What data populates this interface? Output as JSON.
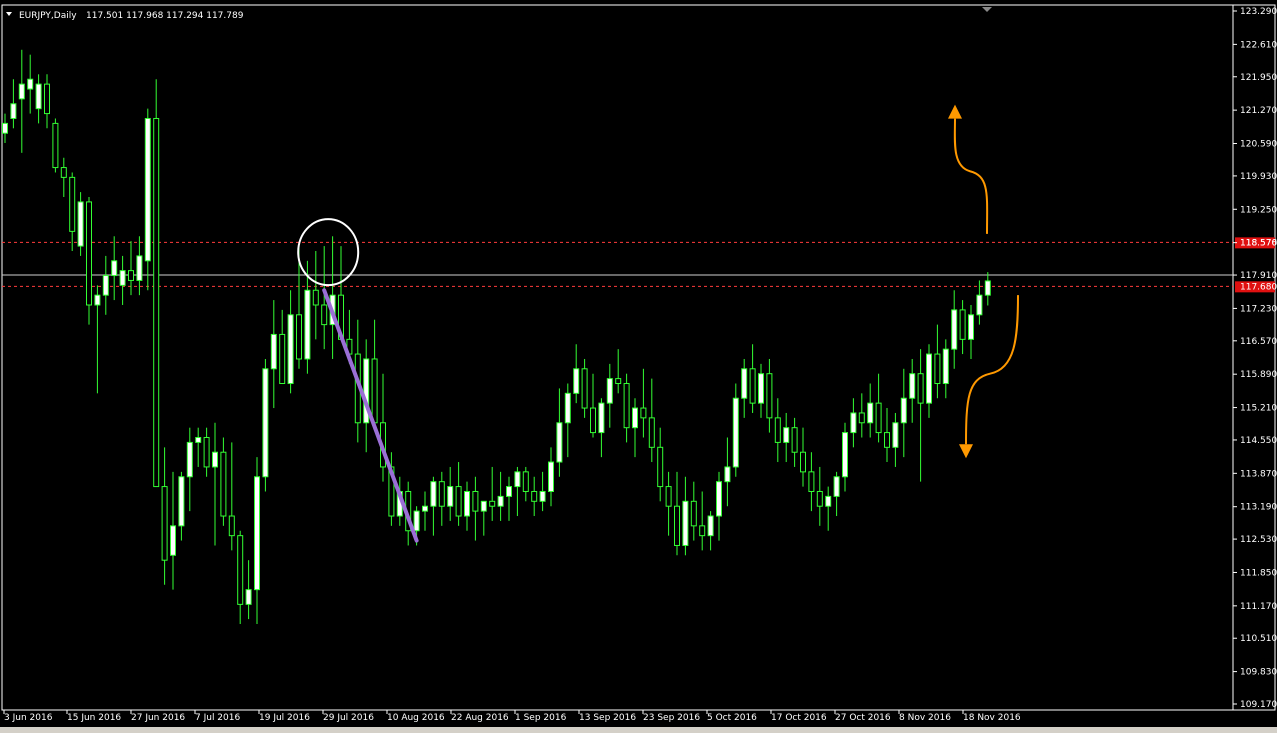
{
  "header": {
    "symbol": "EURJPY,Daily",
    "ohlc": "117.501 117.968 117.294 117.789"
  },
  "colors": {
    "background": "#000000",
    "bull": "#ffffff",
    "wick": "#33ff33",
    "bear": "#000000",
    "grid_line": "#ffffff",
    "resistance": "#ff3b3b",
    "badge": "#e01010",
    "trendline": "#9b6fd6",
    "arrow": "#ff9900",
    "circle": "#ffffff"
  },
  "chart_data": {
    "type": "candlestick",
    "y_ticks": [
      "123.290",
      "122.610",
      "121.950",
      "121.270",
      "120.590",
      "119.930",
      "119.250",
      "118.570",
      "117.910",
      "117.230",
      "116.570",
      "115.890",
      "115.210",
      "114.550",
      "113.870",
      "113.190",
      "112.530",
      "111.850",
      "111.170",
      "110.510",
      "109.830",
      "109.170"
    ],
    "x_ticks": [
      "3 Jun 2016",
      "15 Jun 2016",
      "27 Jun 2016",
      "7 Jul 2016",
      "19 Jul 2016",
      "29 Jul 2016",
      "10 Aug 2016",
      "22 Aug 2016",
      "1 Sep 2016",
      "13 Sep 2016",
      "23 Sep 2016",
      "5 Oct 2016",
      "17 Oct 2016",
      "27 Oct 2016",
      "8 Nov 2016",
      "18 Nov 2016"
    ],
    "ylim": [
      109.17,
      123.29
    ],
    "levels": [
      {
        "label": "118.576",
        "value": 118.576,
        "style": "dashed"
      },
      {
        "label": "117.910",
        "value": 117.91,
        "style": "solid-white"
      },
      {
        "label": "117.680",
        "value": 117.68,
        "style": "dashed"
      }
    ],
    "candles": [
      [
        120.8,
        121.2,
        120.6,
        121.0
      ],
      [
        121.1,
        121.9,
        120.9,
        121.4
      ],
      [
        121.5,
        122.5,
        120.4,
        121.8
      ],
      [
        121.7,
        122.4,
        121.2,
        121.9
      ],
      [
        121.3,
        122.0,
        121.0,
        121.8
      ],
      [
        121.8,
        122.0,
        120.9,
        121.2
      ],
      [
        121.0,
        121.1,
        120.0,
        120.1
      ],
      [
        120.1,
        120.3,
        119.5,
        119.9
      ],
      [
        119.9,
        120.0,
        118.4,
        118.8
      ],
      [
        118.5,
        119.6,
        118.3,
        119.4
      ],
      [
        119.4,
        119.5,
        116.9,
        117.3
      ],
      [
        117.3,
        117.7,
        115.5,
        117.5
      ],
      [
        117.5,
        118.3,
        117.1,
        117.9
      ],
      [
        117.9,
        118.7,
        117.4,
        118.2
      ],
      [
        117.7,
        118.3,
        117.3,
        118.0
      ],
      [
        118.0,
        118.6,
        117.5,
        117.8
      ],
      [
        117.8,
        118.7,
        117.5,
        118.3
      ],
      [
        118.2,
        121.3,
        117.6,
        121.1
      ],
      [
        121.1,
        121.9,
        113.8,
        113.6
      ],
      [
        113.6,
        114.4,
        111.6,
        112.1
      ],
      [
        112.2,
        113.9,
        111.5,
        112.8
      ],
      [
        112.8,
        113.9,
        112.5,
        113.8
      ],
      [
        113.8,
        114.8,
        113.1,
        114.5
      ],
      [
        114.5,
        114.8,
        114.0,
        114.6
      ],
      [
        114.6,
        114.8,
        113.8,
        114.0
      ],
      [
        114.0,
        114.9,
        112.4,
        114.3
      ],
      [
        114.3,
        114.6,
        112.8,
        113.0
      ],
      [
        113.0,
        114.5,
        112.3,
        112.6
      ],
      [
        112.6,
        112.7,
        110.8,
        111.2
      ],
      [
        111.2,
        112.1,
        110.9,
        111.5
      ],
      [
        111.5,
        114.2,
        110.8,
        113.8
      ],
      [
        113.8,
        116.2,
        113.5,
        116.0
      ],
      [
        116.0,
        117.4,
        115.2,
        116.7
      ],
      [
        116.7,
        117.2,
        115.7,
        115.7
      ],
      [
        115.7,
        117.6,
        115.5,
        117.1
      ],
      [
        117.1,
        118.5,
        116.0,
        116.2
      ],
      [
        116.2,
        118.2,
        115.9,
        117.6
      ],
      [
        117.6,
        118.4,
        116.6,
        117.3
      ],
      [
        117.3,
        118.5,
        116.4,
        116.9
      ],
      [
        116.9,
        118.7,
        116.2,
        117.5
      ],
      [
        117.5,
        118.5,
        116.6,
        116.6
      ],
      [
        116.6,
        117.2,
        116.1,
        116.3
      ],
      [
        116.3,
        117.0,
        114.5,
        114.9
      ],
      [
        114.9,
        116.6,
        114.3,
        116.2
      ],
      [
        116.2,
        117.0,
        114.8,
        114.9
      ],
      [
        114.9,
        115.9,
        113.7,
        114.0
      ],
      [
        114.0,
        114.3,
        112.8,
        113.0
      ],
      [
        113.0,
        113.8,
        112.8,
        113.5
      ],
      [
        113.5,
        113.7,
        112.4,
        112.7
      ],
      [
        112.7,
        113.2,
        112.4,
        113.1
      ],
      [
        113.1,
        113.5,
        112.7,
        113.2
      ],
      [
        113.2,
        113.8,
        112.6,
        113.7
      ],
      [
        113.7,
        113.9,
        112.8,
        113.2
      ],
      [
        113.2,
        114.0,
        112.9,
        113.6
      ],
      [
        113.6,
        114.1,
        112.8,
        113.0
      ],
      [
        113.0,
        113.7,
        112.7,
        113.5
      ],
      [
        113.5,
        113.8,
        112.5,
        113.1
      ],
      [
        113.1,
        113.3,
        112.6,
        113.3
      ],
      [
        113.3,
        114.0,
        112.9,
        113.2
      ],
      [
        113.2,
        113.9,
        112.9,
        113.4
      ],
      [
        113.4,
        113.8,
        112.9,
        113.6
      ],
      [
        113.6,
        114.0,
        113.0,
        113.9
      ],
      [
        113.9,
        114.0,
        113.3,
        113.5
      ],
      [
        113.5,
        113.8,
        113.0,
        113.3
      ],
      [
        113.3,
        113.9,
        113.1,
        113.5
      ],
      [
        113.5,
        114.4,
        113.2,
        114.1
      ],
      [
        114.1,
        115.6,
        113.8,
        114.9
      ],
      [
        114.9,
        115.7,
        114.2,
        115.5
      ],
      [
        115.5,
        116.5,
        115.3,
        116.0
      ],
      [
        116.0,
        116.2,
        115.0,
        115.2
      ],
      [
        115.2,
        115.9,
        114.6,
        114.7
      ],
      [
        114.7,
        115.4,
        114.2,
        115.3
      ],
      [
        115.3,
        116.1,
        114.8,
        115.8
      ],
      [
        115.8,
        116.4,
        115.5,
        115.7
      ],
      [
        115.7,
        115.9,
        114.5,
        114.8
      ],
      [
        114.8,
        115.4,
        114.2,
        115.2
      ],
      [
        115.2,
        116.0,
        114.6,
        115.0
      ],
      [
        115.0,
        115.8,
        114.1,
        114.4
      ],
      [
        114.4,
        114.8,
        113.3,
        113.6
      ],
      [
        113.6,
        113.9,
        112.6,
        113.2
      ],
      [
        113.2,
        113.9,
        112.2,
        112.4
      ],
      [
        112.4,
        113.8,
        112.2,
        113.3
      ],
      [
        113.3,
        113.7,
        112.5,
        112.8
      ],
      [
        112.8,
        113.5,
        112.3,
        112.6
      ],
      [
        112.6,
        113.1,
        112.3,
        113.0
      ],
      [
        113.0,
        113.9,
        112.5,
        113.7
      ],
      [
        113.7,
        114.6,
        113.2,
        114.0
      ],
      [
        114.0,
        115.7,
        113.8,
        115.4
      ],
      [
        115.4,
        116.2,
        115.0,
        116.0
      ],
      [
        116.0,
        116.5,
        115.1,
        115.3
      ],
      [
        115.3,
        116.1,
        115.0,
        115.9
      ],
      [
        115.9,
        116.2,
        114.7,
        115.0
      ],
      [
        115.0,
        115.4,
        114.1,
        114.5
      ],
      [
        114.5,
        115.1,
        114.1,
        114.8
      ],
      [
        114.8,
        115.0,
        114.0,
        114.3
      ],
      [
        114.3,
        114.8,
        113.6,
        113.9
      ],
      [
        113.9,
        114.3,
        113.1,
        113.5
      ],
      [
        113.5,
        114.0,
        112.8,
        113.2
      ],
      [
        113.2,
        113.6,
        112.7,
        113.4
      ],
      [
        113.4,
        113.9,
        113.0,
        113.8
      ],
      [
        113.8,
        114.9,
        113.5,
        114.7
      ],
      [
        114.7,
        115.4,
        114.4,
        115.1
      ],
      [
        115.1,
        115.5,
        114.6,
        114.9
      ],
      [
        114.9,
        115.7,
        114.6,
        115.3
      ],
      [
        115.3,
        115.9,
        114.5,
        114.7
      ],
      [
        114.7,
        115.2,
        114.1,
        114.4
      ],
      [
        114.4,
        115.1,
        114.0,
        114.9
      ],
      [
        114.9,
        116.0,
        114.2,
        115.4
      ],
      [
        115.4,
        116.2,
        114.9,
        115.9
      ],
      [
        115.9,
        116.4,
        113.7,
        115.3
      ],
      [
        115.3,
        116.5,
        115.0,
        116.3
      ],
      [
        116.3,
        116.9,
        115.4,
        115.7
      ],
      [
        115.7,
        116.6,
        115.4,
        116.4
      ],
      [
        116.4,
        117.6,
        116.0,
        117.2
      ],
      [
        117.2,
        117.4,
        116.3,
        116.6
      ],
      [
        116.6,
        117.3,
        116.2,
        117.1
      ],
      [
        117.1,
        117.8,
        116.9,
        117.5
      ],
      [
        117.5,
        117.97,
        117.29,
        117.79
      ]
    ],
    "annotations": [
      {
        "type": "circle",
        "center_index": 38,
        "around_price": 118.5
      },
      {
        "type": "trendline",
        "from": {
          "index": 38,
          "price": 117.6
        },
        "to": {
          "index": 49,
          "price": 112.5
        }
      },
      {
        "type": "curved-arrow",
        "direction": "up",
        "from_price": 118.75,
        "to_price": 121.3
      },
      {
        "type": "curved-arrow",
        "direction": "down",
        "from_price": 117.5,
        "to_price": 114.3
      }
    ]
  }
}
